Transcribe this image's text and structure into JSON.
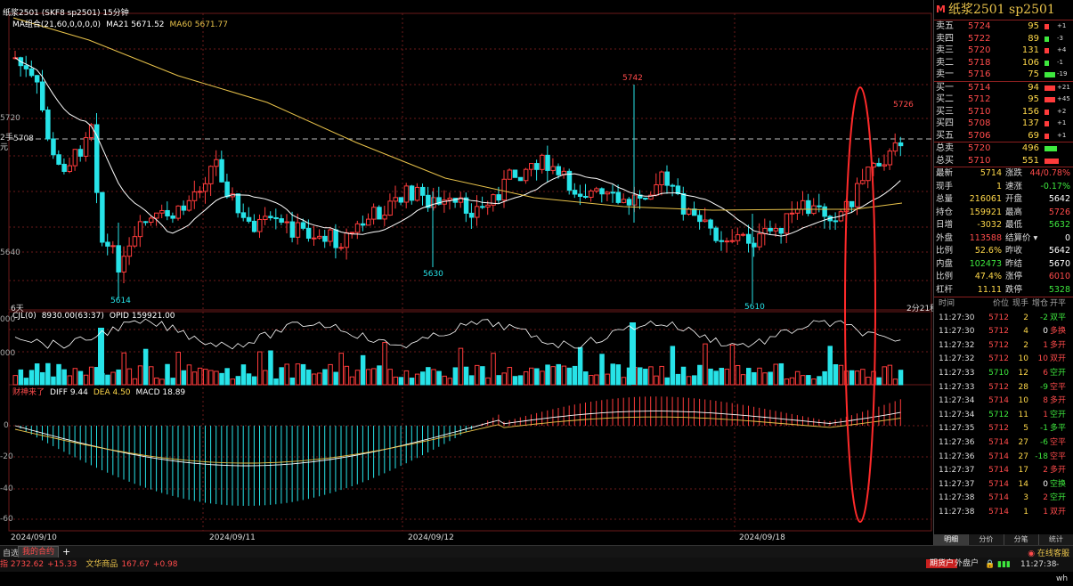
{
  "header": {
    "title": "纸浆2501 (SKF8 sp2501)  15分钟",
    "ma_legend": [
      {
        "text": "MA组合(21,60,0,0,0,0)",
        "color": "#ffffff"
      },
      {
        "text": "MA21 5671.52",
        "color": "#ffffff"
      },
      {
        "text": "MA60 5671.77",
        "color": "#e8c24a"
      }
    ],
    "vol_legend": [
      {
        "text": "CJL(0)",
        "color": "#ffffff"
      },
      {
        "text": "8930.00(63:37)",
        "color": "#ffffff"
      },
      {
        "text": "OPID 159921.00",
        "color": "#ffffff"
      }
    ],
    "macd_legend": [
      {
        "text": "财神来了",
        "color": "#ff4b4b"
      },
      {
        "text": "DIFF 9.44",
        "color": "#ffffff"
      },
      {
        "text": "DEA 4.50",
        "color": "#ffd84a"
      },
      {
        "text": "MACD 18.89",
        "color": "#ffffff"
      }
    ]
  },
  "chart": {
    "axis_labels": {
      "p1": "5720",
      "p2": "5708",
      "p3": "5640",
      "p4": "2手",
      "p5": "元",
      "cursor_price": "5708"
    },
    "vol_axis": [
      "000",
      "000"
    ],
    "macd_axis": [
      "0",
      "-20",
      "-40",
      "-60"
    ],
    "annotations": {
      "high": "5742",
      "low1": "5614",
      "low2": "5630",
      "low3": "5610",
      "last_high": "5726"
    },
    "x_labels": [
      "2024/09/10",
      "2024/09/11",
      "2024/09/12",
      "2024/09/18"
    ],
    "left_note": "6天",
    "countdown": "2分21秒",
    "colors": {
      "up": "#ff3b3b",
      "down": "#27e3e8",
      "ma21": "#ffffff",
      "ma60": "#e8c24a",
      "grid": "#6b1a1a"
    }
  },
  "panel": {
    "m_badge": "M",
    "title": "纸浆2501  sp2501",
    "asks": [
      {
        "label": "卖五",
        "price": "5724",
        "vol": "95",
        "chg": "+1"
      },
      {
        "label": "卖四",
        "price": "5722",
        "vol": "89",
        "chg": "-3"
      },
      {
        "label": "卖三",
        "price": "5720",
        "vol": "131",
        "chg": "+4"
      },
      {
        "label": "卖二",
        "price": "5718",
        "vol": "106",
        "chg": "-1"
      },
      {
        "label": "卖一",
        "price": "5716",
        "vol": "75",
        "chg": "-19"
      }
    ],
    "bids": [
      {
        "label": "买一",
        "price": "5714",
        "vol": "94",
        "chg": "+21"
      },
      {
        "label": "买二",
        "price": "5712",
        "vol": "95",
        "chg": "+45"
      },
      {
        "label": "买三",
        "price": "5710",
        "vol": "156",
        "chg": "+2"
      },
      {
        "label": "买四",
        "price": "5708",
        "vol": "137",
        "chg": "+1"
      },
      {
        "label": "买五",
        "price": "5706",
        "vol": "69",
        "chg": "+1"
      }
    ],
    "totals": [
      {
        "label": "总卖",
        "price": "5720",
        "vol": "496"
      },
      {
        "label": "总买",
        "price": "5710",
        "vol": "551"
      }
    ],
    "quote": [
      {
        "l1": "最新",
        "v1": "5714",
        "c1": "#ffd84a",
        "l2": "涨跌",
        "v2": "44/0.78%",
        "c2": "#ff4b4b"
      },
      {
        "l1": "现手",
        "v1": "1",
        "c1": "#ffd84a",
        "l2": "速涨",
        "v2": "-0.17%",
        "c2": "#3ee83e"
      },
      {
        "l1": "总量",
        "v1": "216061",
        "c1": "#ffd84a",
        "l2": "开盘",
        "v2": "5642",
        "c2": "#ffffff"
      },
      {
        "l1": "持仓",
        "v1": "159921",
        "c1": "#ffd84a",
        "l2": "最高",
        "v2": "5726",
        "c2": "#ff4b4b"
      },
      {
        "l1": "日增",
        "v1": "-3032",
        "c1": "#ffd84a",
        "l2": "最低",
        "v2": "5632",
        "c2": "#3ee83e"
      },
      {
        "l1": "外盘",
        "v1": "113588",
        "c1": "#ff4b4b",
        "l2": "结算价 ▾",
        "v2": "0",
        "c2": "#ffffff"
      },
      {
        "l1": "比例",
        "v1": "52.6%",
        "c1": "#ffd84a",
        "l2": "昨收",
        "v2": "5642",
        "c2": "#ffffff"
      },
      {
        "l1": "内盘",
        "v1": "102473",
        "c1": "#3ee83e",
        "l2": "昨结",
        "v2": "5670",
        "c2": "#ffffff"
      },
      {
        "l1": "比例",
        "v1": "47.4%",
        "c1": "#ffd84a",
        "l2": "涨停",
        "v2": "6010",
        "c2": "#ff4b4b"
      },
      {
        "l1": "杠杆",
        "v1": "11.11",
        "c1": "#ffd84a",
        "l2": "跌停",
        "v2": "5328",
        "c2": "#3ee83e"
      }
    ],
    "ticks_header": [
      "时间",
      "价位",
      "现手",
      "增仓",
      "开平"
    ],
    "ticks": [
      {
        "time": "11:27:30",
        "price": "5712",
        "vol": "2",
        "oi": "-2",
        "type": "双平",
        "pc": "#ff4b4b",
        "oc": "#3ee83e",
        "tc": "#3ee83e"
      },
      {
        "time": "11:27:30",
        "price": "5712",
        "vol": "4",
        "oi": "0",
        "type": "多换",
        "pc": "#ff4b4b",
        "oc": "#ffffff",
        "tc": "#ff4b4b"
      },
      {
        "time": "11:27:32",
        "price": "5712",
        "vol": "2",
        "oi": "1",
        "type": "多开",
        "pc": "#ff4b4b",
        "oc": "#ff4b4b",
        "tc": "#ff4b4b"
      },
      {
        "time": "11:27:32",
        "price": "5712",
        "vol": "10",
        "oi": "10",
        "type": "双开",
        "pc": "#ff4b4b",
        "oc": "#ff4b4b",
        "tc": "#ff4b4b"
      },
      {
        "time": "11:27:33",
        "price": "5710",
        "vol": "12",
        "oi": "6",
        "type": "空开",
        "pc": "#3ee83e",
        "oc": "#ff4b4b",
        "tc": "#3ee83e"
      },
      {
        "time": "11:27:33",
        "price": "5712",
        "vol": "28",
        "oi": "-9",
        "type": "空平",
        "pc": "#ff4b4b",
        "oc": "#3ee83e",
        "tc": "#ff4b4b"
      },
      {
        "time": "11:27:34",
        "price": "5714",
        "vol": "10",
        "oi": "8",
        "type": "多开",
        "pc": "#ff4b4b",
        "oc": "#ff4b4b",
        "tc": "#ff4b4b"
      },
      {
        "time": "11:27:34",
        "price": "5712",
        "vol": "11",
        "oi": "1",
        "type": "空开",
        "pc": "#3ee83e",
        "oc": "#ff4b4b",
        "tc": "#3ee83e"
      },
      {
        "time": "11:27:35",
        "price": "5712",
        "vol": "5",
        "oi": "-1",
        "type": "多平",
        "pc": "#ff4b4b",
        "oc": "#3ee83e",
        "tc": "#3ee83e"
      },
      {
        "time": "11:27:36",
        "price": "5714",
        "vol": "27",
        "oi": "-6",
        "type": "空平",
        "pc": "#ff4b4b",
        "oc": "#3ee83e",
        "tc": "#ff4b4b"
      },
      {
        "time": "11:27:36",
        "price": "5714",
        "vol": "27",
        "oi": "-18",
        "type": "空平",
        "pc": "#ff4b4b",
        "oc": "#3ee83e",
        "tc": "#ff4b4b"
      },
      {
        "time": "11:27:37",
        "price": "5714",
        "vol": "17",
        "oi": "2",
        "type": "多开",
        "pc": "#ff4b4b",
        "oc": "#ff4b4b",
        "tc": "#ff4b4b"
      },
      {
        "time": "11:27:37",
        "price": "5714",
        "vol": "14",
        "oi": "0",
        "type": "空换",
        "pc": "#ff4b4b",
        "oc": "#ffffff",
        "tc": "#3ee83e"
      },
      {
        "time": "11:27:38",
        "price": "5714",
        "vol": "3",
        "oi": "2",
        "type": "空开",
        "pc": "#ff4b4b",
        "oc": "#ff4b4b",
        "tc": "#3ee83e"
      },
      {
        "time": "11:27:38",
        "price": "5714",
        "vol": "1",
        "oi": "1",
        "type": "双开",
        "pc": "#ff4b4b",
        "oc": "#ff4b4b",
        "tc": "#ff4b4b"
      }
    ],
    "tabs": [
      "明细",
      "分价",
      "分笔",
      "统计"
    ]
  },
  "bottom": {
    "tab_left": "自选",
    "tab_active": "我的合约",
    "tab_add": "+",
    "online_service": "在线客服",
    "ticker": [
      {
        "text": "指 2732.62",
        "color": "#ff4b4b"
      },
      {
        "text": "+15.33",
        "color": "#ff4b4b"
      },
      {
        "text": "文华商品",
        "color": "#e8c24a"
      },
      {
        "text": "167.67",
        "color": "#ff4b4b"
      },
      {
        "text": "+0.98",
        "color": "#ff4b4b"
      }
    ],
    "futures_account": "期货户",
    "external_account": "外盘户",
    "clock": "11:27:38",
    "user": "- wh"
  }
}
